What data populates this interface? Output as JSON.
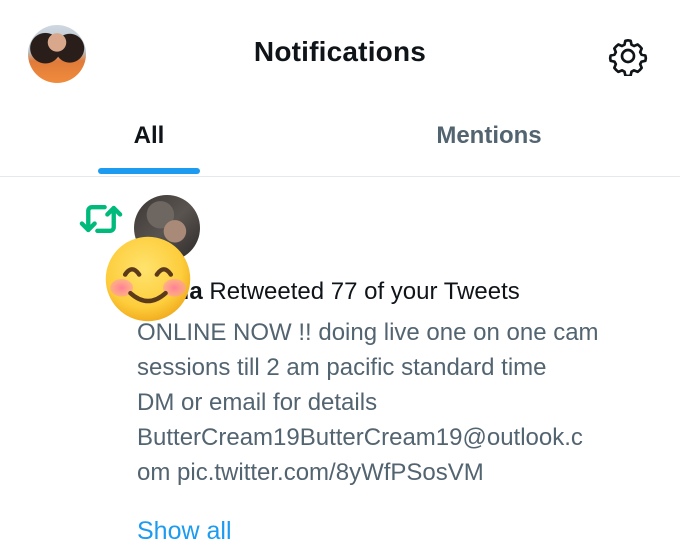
{
  "header": {
    "title": "Notifications",
    "avatar_icon": "profile-avatar",
    "settings_icon": "gear-icon"
  },
  "tabs": [
    {
      "label": "All",
      "active": true
    },
    {
      "label": "Mentions",
      "active": false
    }
  ],
  "notification": {
    "type_icon": "retweet-icon",
    "actor_name_visible": "lla",
    "action_text": " Retweeted 77 of your Tweets",
    "tweet_lines": [
      "ONLINE NOW !! doing live one on one cam",
      "sessions till 2 am pacific standard time",
      "DM or email for details",
      "ButterCream19ButterCream19@outlook.c",
      "om pic.twitter.com/8yWfPSosVM"
    ],
    "show_all_label": "Show all",
    "overlay": "smiling-face-emoji"
  },
  "colors": {
    "accent": "#1d9bf0",
    "retweet_green": "#00ba7c",
    "text_primary": "#0f1419",
    "text_secondary": "#536471",
    "divider": "#e6e9ec"
  }
}
